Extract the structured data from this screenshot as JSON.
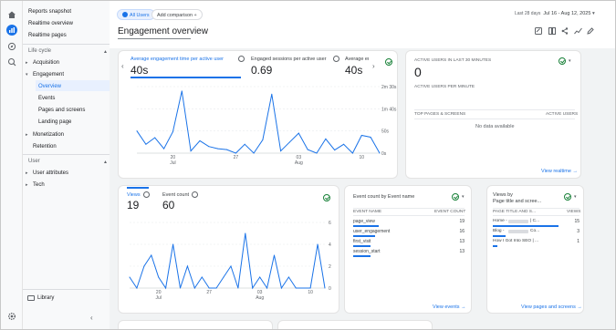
{
  "nav": {
    "items": [
      {
        "label": "Reports snapshot"
      },
      {
        "label": "Realtime overview"
      },
      {
        "label": "Realtime pages"
      },
      {
        "label": "Life cycle"
      },
      {
        "label": "Acquisition"
      },
      {
        "label": "Engagement"
      },
      {
        "label": "Overview"
      },
      {
        "label": "Events"
      },
      {
        "label": "Pages and screens"
      },
      {
        "label": "Landing page"
      },
      {
        "label": "Monetization"
      },
      {
        "label": "Retention"
      },
      {
        "label": "User"
      },
      {
        "label": "User attributes"
      },
      {
        "label": "Tech"
      },
      {
        "label": "Library"
      }
    ]
  },
  "top": {
    "comparison_chip": "All Users",
    "add_comparison": "Add comparison",
    "date_prefix": "Last 28 days",
    "date_range": "Jul 16 - Aug 12, 2025",
    "page_title": "Engagement overview"
  },
  "overview": {
    "metrics": [
      {
        "label": "Average engagement time per active user",
        "value": "40s"
      },
      {
        "label": "Engaged sessions per active user",
        "value": "0.69"
      },
      {
        "label": "Average eng",
        "value": "40s"
      }
    ],
    "y_ticks": [
      "2m 30s",
      "1m 40s",
      "50s",
      "0s"
    ],
    "x_ticks": [
      {
        "l1": "20",
        "l2": "Jul"
      },
      {
        "l1": "27",
        "l2": ""
      },
      {
        "l1": "03",
        "l2": "Aug"
      },
      {
        "l1": "10",
        "l2": ""
      }
    ]
  },
  "realtime": {
    "title": "ACTIVE USERS IN LAST 30 MINUTES",
    "value": "0",
    "subtitle": "ACTIVE USERS PER MINUTE",
    "col1": "TOP PAGES & SCREENS",
    "col2": "ACTIVE USERS",
    "empty": "No data available",
    "link": "View realtime"
  },
  "views": {
    "tab1": "Views",
    "value1": "19",
    "tab2": "Event count",
    "value2": "60",
    "y_ticks": [
      "6",
      "4",
      "2",
      "0"
    ],
    "x_ticks": [
      {
        "l1": "20",
        "l2": "Jul"
      },
      {
        "l1": "27",
        "l2": ""
      },
      {
        "l1": "03",
        "l2": "Aug"
      },
      {
        "l1": "10",
        "l2": ""
      }
    ]
  },
  "events": {
    "title": "Event count by Event name",
    "col1": "EVENT NAME",
    "col2": "EVENT COUNT",
    "rows": [
      {
        "name": "page_view",
        "count": "19"
      },
      {
        "name": "user_engagement",
        "count": "16"
      },
      {
        "name": "first_visit",
        "count": "13"
      },
      {
        "name": "session_start",
        "count": "13"
      }
    ],
    "link": "View events"
  },
  "pages": {
    "title": "Views by",
    "subtitle": "Page title and scree...",
    "col1": "PAGE TITLE AND S...",
    "col2": "VIEWS",
    "rows": [
      {
        "name": "Home - ",
        "suffix": "| C...",
        "count": "15"
      },
      {
        "name": "Blog - ",
        "suffix": "Co...",
        "count": "3"
      },
      {
        "name": "How I Got Into SEO | ...",
        "suffix": "",
        "count": "1"
      }
    ],
    "link": "View pages and screens"
  },
  "chart_data": [
    {
      "type": "line",
      "title": "",
      "xlabel": "",
      "ylabel": "",
      "ylim": [
        0,
        150
      ],
      "x": [
        "Jul 16",
        "Jul 17",
        "Jul 18",
        "Jul 19",
        "Jul 20",
        "Jul 21",
        "Jul 22",
        "Jul 23",
        "Jul 24",
        "Jul 25",
        "Jul 26",
        "Jul 27",
        "Jul 28",
        "Jul 29",
        "Jul 30",
        "Jul 31",
        "Aug 01",
        "Aug 02",
        "Aug 03",
        "Aug 04",
        "Aug 05",
        "Aug 06",
        "Aug 07",
        "Aug 08",
        "Aug 09",
        "Aug 10",
        "Aug 11",
        "Aug 12"
      ],
      "series": [
        {
          "name": "",
          "values": [
            50,
            20,
            35,
            10,
            48,
            140,
            5,
            28,
            15,
            10,
            8,
            0,
            20,
            0,
            30,
            133,
            5,
            25,
            45,
            8,
            0,
            32,
            7,
            20,
            0,
            40,
            36,
            0
          ]
        }
      ]
    },
    {
      "type": "line",
      "title": "",
      "xlabel": "",
      "ylabel": "",
      "ylim": [
        0,
        6
      ],
      "x": [
        "Jul 16",
        "Jul 17",
        "Jul 18",
        "Jul 19",
        "Jul 20",
        "Jul 21",
        "Jul 22",
        "Jul 23",
        "Jul 24",
        "Jul 25",
        "Jul 26",
        "Jul 27",
        "Jul 28",
        "Jul 29",
        "Jul 30",
        "Jul 31",
        "Aug 01",
        "Aug 02",
        "Aug 03",
        "Aug 04",
        "Aug 05",
        "Aug 06",
        "Aug 07",
        "Aug 08",
        "Aug 09",
        "Aug 10",
        "Aug 11",
        "Aug 12"
      ],
      "series": [
        {
          "name": "",
          "values": [
            1,
            0,
            2,
            3,
            1,
            0,
            4,
            0,
            2,
            0,
            1,
            0,
            0,
            1,
            2,
            0,
            5,
            0,
            1,
            0,
            3,
            0,
            1,
            0,
            0,
            0,
            4,
            0
          ]
        }
      ]
    }
  ]
}
